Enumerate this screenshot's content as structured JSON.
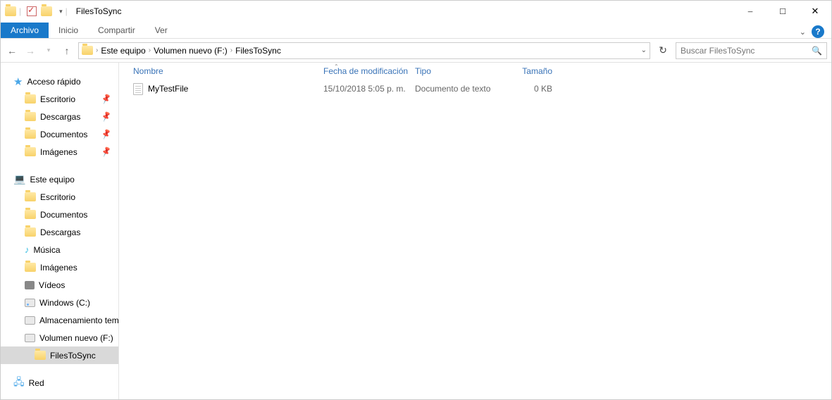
{
  "window": {
    "title": "FilesToSync"
  },
  "ribbon": {
    "file": "Archivo",
    "tabs": [
      "Inicio",
      "Compartir",
      "Ver"
    ]
  },
  "address": {
    "crumbs": [
      "Este equipo",
      "Volumen nuevo (F:)",
      "FilesToSync"
    ]
  },
  "search": {
    "placeholder": "Buscar FilesToSync"
  },
  "sidebar": {
    "quick": {
      "label": "Acceso rápido",
      "items": [
        {
          "label": "Escritorio",
          "pinned": true
        },
        {
          "label": "Descargas",
          "pinned": true
        },
        {
          "label": "Documentos",
          "pinned": true
        },
        {
          "label": "Imágenes",
          "pinned": true
        }
      ]
    },
    "pc": {
      "label": "Este equipo",
      "items": [
        {
          "label": "Escritorio"
        },
        {
          "label": "Documentos"
        },
        {
          "label": "Descargas"
        },
        {
          "label": "Música"
        },
        {
          "label": "Imágenes"
        },
        {
          "label": "Vídeos"
        },
        {
          "label": "Windows (C:)"
        },
        {
          "label": "Almacenamiento temporal"
        },
        {
          "label": "Volumen nuevo (F:)"
        }
      ],
      "sub": {
        "label": "FilesToSync"
      }
    },
    "network": {
      "label": "Red"
    }
  },
  "columns": {
    "name": "Nombre",
    "date": "Fecha de modificación",
    "type": "Tipo",
    "size": "Tamaño"
  },
  "files": [
    {
      "name": "MyTestFile",
      "date": "15/10/2018 5:05 p. m.",
      "type": "Documento de texto",
      "size": "0 KB"
    }
  ]
}
